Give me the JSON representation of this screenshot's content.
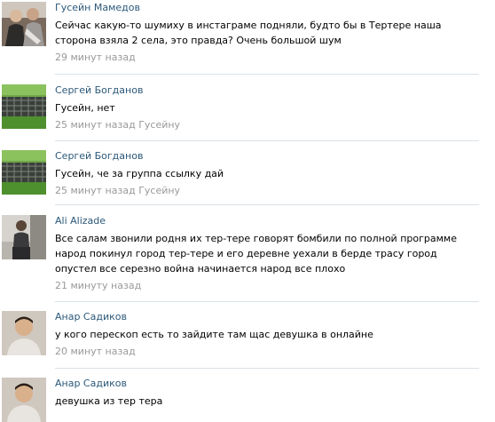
{
  "comments": [
    {
      "author": "Гусейн Мамедов",
      "text": "Сейчас какую-то шумиху в инстаграме подняли, будто бы в Тертере наша сторона взяла 2 села, это правда? Очень большой шум",
      "time": "29 минут назад",
      "reply_to": "",
      "avatar_icon": "group-photo-avatar"
    },
    {
      "author": "Сергей Богданов",
      "text": "Гусейн, нет",
      "time": "25 минут назад",
      "reply_to": "Гусейну",
      "avatar_icon": "grass-fence-avatar"
    },
    {
      "author": "Сергей Богданов",
      "text": "Гусейн, че за группа ссылку дай",
      "time": "25 минут назад",
      "reply_to": "Гусейну",
      "avatar_icon": "grass-fence-avatar"
    },
    {
      "author": "Ali Alizade",
      "text": "Все салам звонили родня их тер-тере говорят бомбили по полной программе народ покинул город тер-тере и его деревне уехали в берде трасу город опустел все серезно война начинается народ все плохо",
      "time": "21 минуту назад",
      "reply_to": "",
      "avatar_icon": "man-standing-avatar"
    },
    {
      "author": "Анар Садиков",
      "text": "у кого перескоп есть то зайдите там щас девушка в онлайне",
      "time": "20 минут назад",
      "reply_to": "",
      "avatar_icon": "man-portrait-avatar"
    },
    {
      "author": "Анар Садиков",
      "text": "девушка из тер тера",
      "time": "",
      "reply_to": "",
      "avatar_icon": "man-portrait-avatar"
    }
  ]
}
